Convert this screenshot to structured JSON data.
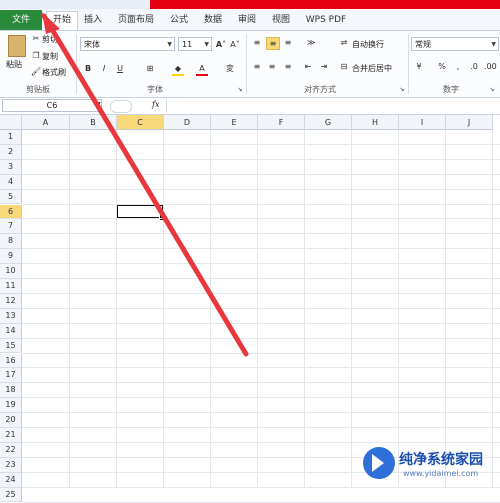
{
  "tabs": {
    "file": "文件",
    "home": "开始",
    "insert": "插入",
    "page_layout": "页面布局",
    "formulas": "公式",
    "data": "数据",
    "review": "审阅",
    "view": "视图",
    "wps_pdf": "WPS PDF"
  },
  "clipboard": {
    "paste": "粘贴",
    "cut": "剪切",
    "copy": "复制",
    "format_painter": "格式刷",
    "group_label": "剪贴板"
  },
  "font": {
    "family": "宋体",
    "size": "11",
    "group_label": "字体",
    "bold": "B",
    "italic": "I",
    "underline": "U",
    "wen": "変"
  },
  "alignment": {
    "wrap_text": "自动换行",
    "merge_center": "合并后居中",
    "group_label": "对齐方式"
  },
  "number": {
    "format": "常规",
    "percent": "%",
    "comma": ",",
    "group_label": "数字"
  },
  "formula_bar": {
    "name_box": "C6",
    "fx": "fx"
  },
  "grid": {
    "columns": [
      "A",
      "B",
      "C",
      "D",
      "E",
      "F",
      "G",
      "H",
      "I",
      "J"
    ],
    "rows": [
      "1",
      "2",
      "3",
      "4",
      "5",
      "6",
      "7",
      "8",
      "9",
      "10",
      "11",
      "12",
      "13",
      "14",
      "15",
      "16",
      "17",
      "18",
      "19",
      "20",
      "21",
      "22",
      "23",
      "24",
      "25"
    ],
    "active_cell": "C6"
  },
  "watermark": {
    "title": "纯净系统家园",
    "url": "www.yidaimei.com"
  },
  "colors": {
    "file_tab": "#2a8a3c",
    "title_red": "#e60012",
    "arrow": "#e8383d",
    "selected_header": "#f8d97a"
  }
}
